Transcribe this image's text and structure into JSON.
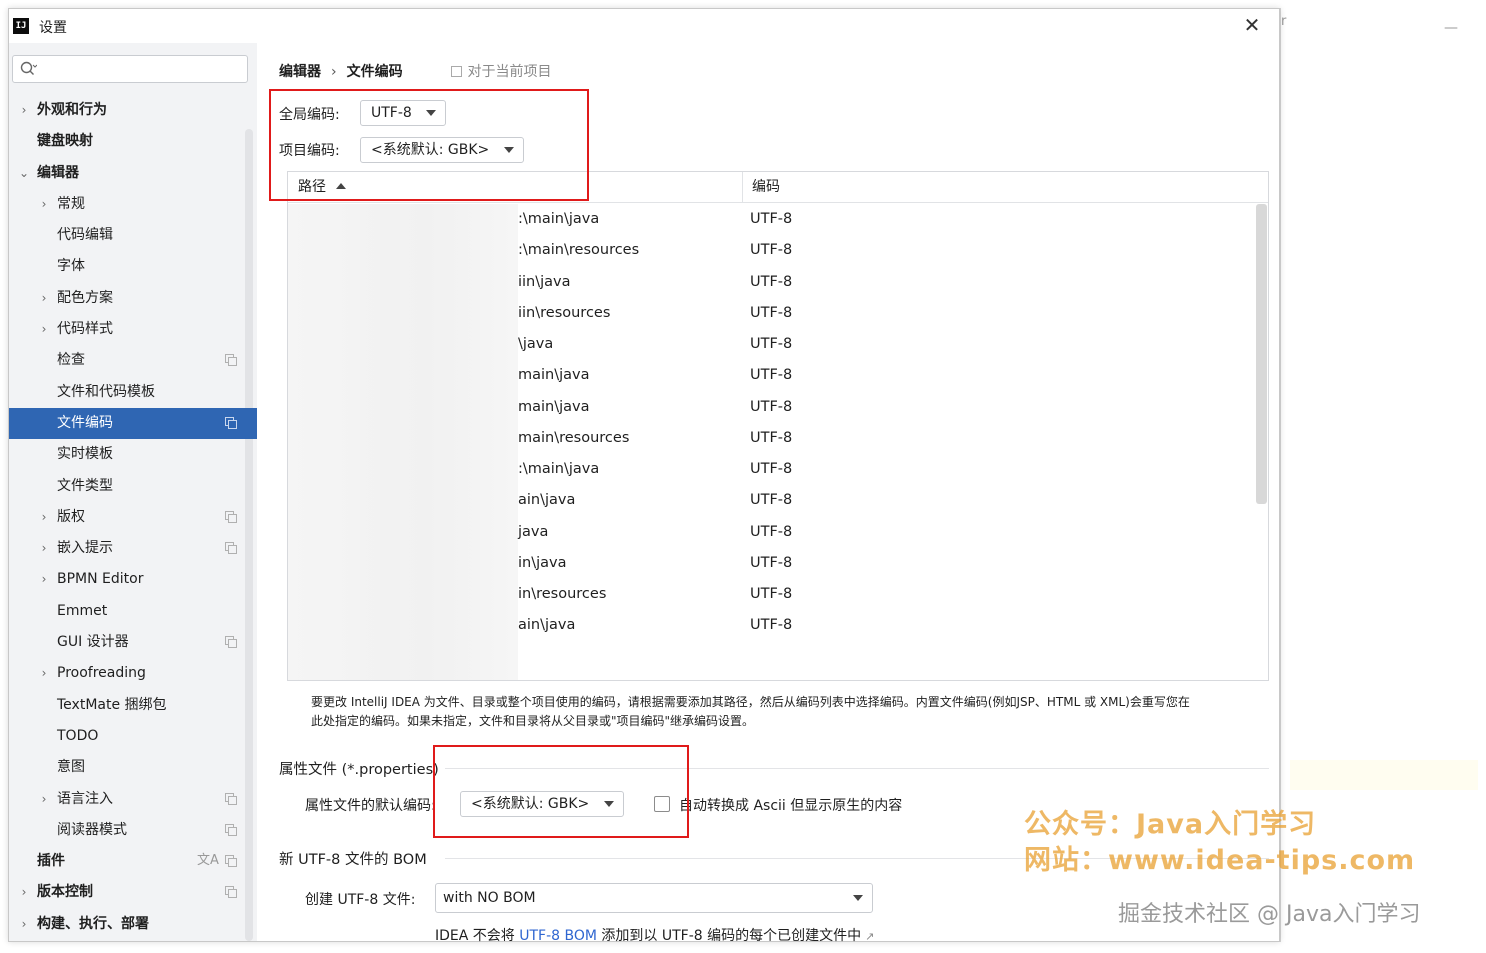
{
  "window": {
    "title": "设置",
    "app_icon": "IJ",
    "close_glyph": "✕"
  },
  "search": {
    "placeholder": ""
  },
  "sidebar": {
    "items": [
      {
        "label": "外观和行为",
        "chevron": "›",
        "bold": true
      },
      {
        "label": "键盘映射",
        "bold": true
      },
      {
        "label": "编辑器",
        "chevron": "⌄",
        "bold": true
      },
      {
        "label": "常规",
        "chevron": "›"
      },
      {
        "label": "代码编辑"
      },
      {
        "label": "字体"
      },
      {
        "label": "配色方案",
        "chevron": "›"
      },
      {
        "label": "代码样式",
        "chevron": "›"
      },
      {
        "label": "检查",
        "icon": "copy-icon"
      },
      {
        "label": "文件和代码模板"
      },
      {
        "label": "文件编码",
        "icon": "copy-icon",
        "selected": true
      },
      {
        "label": "实时模板"
      },
      {
        "label": "文件类型"
      },
      {
        "label": "版权",
        "chevron": "›",
        "icon": "copy-icon"
      },
      {
        "label": "嵌入提示",
        "chevron": "›",
        "icon": "copy-icon"
      },
      {
        "label": "BPMN Editor",
        "chevron": "›"
      },
      {
        "label": "Emmet"
      },
      {
        "label": "GUI 设计器",
        "icon": "copy-icon"
      },
      {
        "label": "Proofreading",
        "chevron": "›"
      },
      {
        "label": "TextMate 捆绑包"
      },
      {
        "label": "TODO"
      },
      {
        "label": "意图"
      },
      {
        "label": "语言注入",
        "chevron": "›",
        "icon": "copy-icon"
      },
      {
        "label": "阅读器模式",
        "icon": "copy-icon"
      },
      {
        "label": "插件",
        "bold": true,
        "icon": "copy-icon",
        "icon2": "文A"
      },
      {
        "label": "版本控制",
        "chevron": "›",
        "bold": true,
        "icon": "copy-icon"
      },
      {
        "label": "构建、执行、部署",
        "chevron": "›",
        "bold": true
      }
    ]
  },
  "breadcrumb": {
    "part1": "编辑器",
    "separator": "›",
    "part2": "文件编码",
    "scope": "对于当前项目"
  },
  "global_encoding": {
    "label": "全局编码:",
    "value": "UTF-8"
  },
  "project_encoding": {
    "label": "项目编码:",
    "value": "<系统默认: GBK>"
  },
  "table": {
    "columns": [
      "路径",
      "编码"
    ],
    "rows": [
      {
        "path": ":\\main\\java",
        "encoding": "UTF-8"
      },
      {
        "path": ":\\main\\resources",
        "encoding": "UTF-8"
      },
      {
        "path": "iin\\java",
        "encoding": "UTF-8"
      },
      {
        "path": "iin\\resources",
        "encoding": "UTF-8"
      },
      {
        "path": "\\java",
        "encoding": "UTF-8"
      },
      {
        "path": "main\\java",
        "encoding": "UTF-8"
      },
      {
        "path": "main\\java",
        "encoding": "UTF-8"
      },
      {
        "path": "main\\resources",
        "encoding": "UTF-8"
      },
      {
        "path": ":\\main\\java",
        "encoding": "UTF-8"
      },
      {
        "path": "ain\\java",
        "encoding": "UTF-8"
      },
      {
        "path": "java",
        "encoding": "UTF-8"
      },
      {
        "path": "in\\java",
        "encoding": "UTF-8"
      },
      {
        "path": "in\\resources",
        "encoding": "UTF-8"
      },
      {
        "path": "ain\\java",
        "encoding": "UTF-8"
      }
    ]
  },
  "description": {
    "line1": "要更改 IntelliJ IDEA 为文件、目录或整个项目使用的编码，请根据需要添加其路径，然后从编码列表中选择编码。内置文件编码(例如JSP、HTML 或 XML)会重写您在",
    "line2": "此处指定的编码。如果未指定，文件和目录将从父目录或\"项目编码\"继承编码设置。"
  },
  "properties": {
    "section_title": "属性文件 (*.properties)",
    "default_label": "属性文件的默认编码:",
    "default_value": "<系统默认: GBK>",
    "checkbox_label": "自动转换成 Ascii 但显示原生的内容",
    "checkbox_checked": false
  },
  "bom": {
    "section_title": "新 UTF-8 文件的 BOM",
    "create_label": "创建 UTF-8 文件:",
    "create_value": "with NO BOM",
    "note_prefix": "IDEA 不会将",
    "note_link": "UTF-8 BOM",
    "note_suffix": "添加到以 UTF-8 编码的每个已创建文件中",
    "note_icon": "↗"
  },
  "watermarks": {
    "line1": "公众号：Java入门学习",
    "line2": "网站：www.idea-tips.com",
    "line3": "掘金技术社区 @ Java入门学习"
  },
  "colors": {
    "accent": "#2f66b3",
    "highlight_box": "#e01a1a",
    "link": "#2f66d0"
  }
}
